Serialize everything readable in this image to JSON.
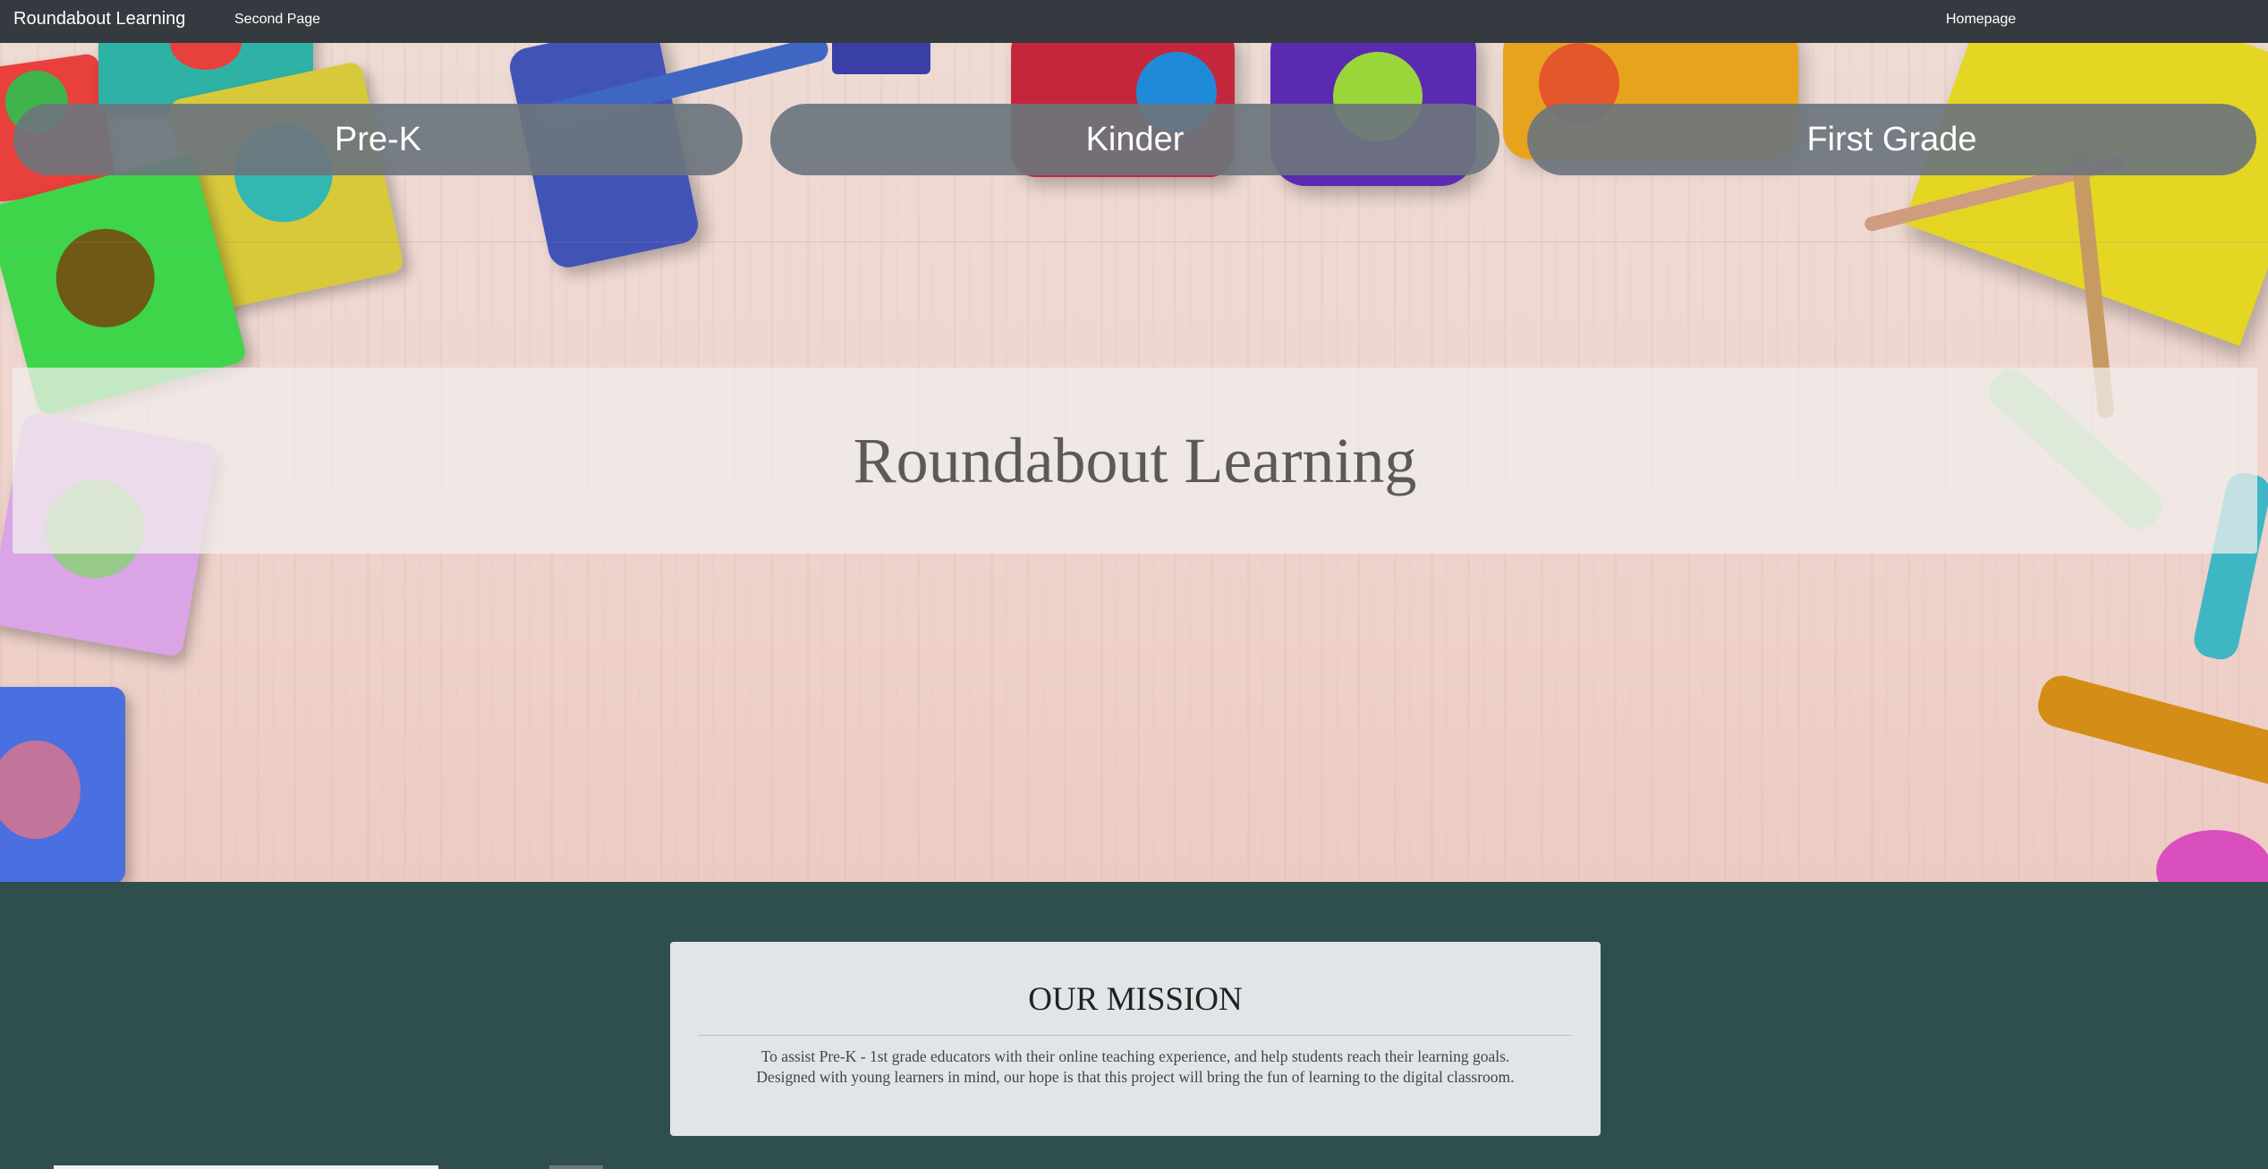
{
  "navbar": {
    "brand": "Roundabout Learning",
    "second_page": "Second Page",
    "homepage": "Homepage"
  },
  "hero": {
    "buttons": [
      {
        "label": "Pre-K"
      },
      {
        "label": "Kinder"
      },
      {
        "label": "First Grade"
      }
    ],
    "title": "Roundabout Learning"
  },
  "mission": {
    "heading": "OUR MISSION",
    "line1": "To assist Pre-K - 1st grade educators with their online teaching experience, and help students reach their learning goals.",
    "line2": "Designed with young learners in mind, our hope is that this project will bring the fun of learning to the digital classroom."
  },
  "colors": {
    "navbar": "#343a40",
    "page_bg": "#2f4f4f",
    "button_bg": "#6c757d",
    "card_bg": "#e0e5e8"
  }
}
